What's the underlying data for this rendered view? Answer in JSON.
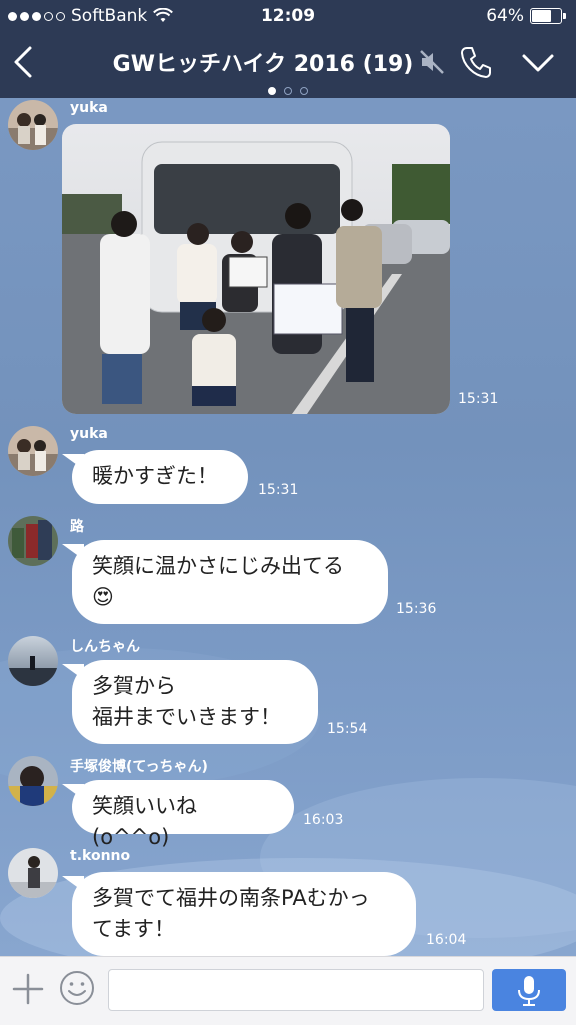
{
  "status_bar": {
    "carrier": "SoftBank",
    "time": "12:09",
    "battery_percent": "64%",
    "battery_level": 0.64,
    "signal_bars_filled": 3,
    "signal_bars_total": 5
  },
  "header": {
    "title": "GWヒッチハイク 2016 (19)",
    "muted": true,
    "page_dots": 3,
    "active_dot": 0
  },
  "messages": [
    {
      "sender": "yuka",
      "type": "image",
      "time": "15:31"
    },
    {
      "sender": "yuka",
      "text": "暖かすぎた！",
      "time": "15:31"
    },
    {
      "sender": "路",
      "lines": [
        "笑顔に温かさにじみ出てる",
        "😍"
      ],
      "time": "15:36"
    },
    {
      "sender": "しんちゃん",
      "lines": [
        "多賀から",
        "福井までいきます！"
      ],
      "time": "15:54"
    },
    {
      "sender": "手塚俊博(てっちゃん)",
      "text": "笑顔いいね(o^^o)",
      "time": "16:03"
    },
    {
      "sender": "t.konno",
      "lines": [
        "多賀でて福井の南条PAむかっ",
        "てます！"
      ],
      "time": "16:04"
    }
  ],
  "input": {
    "placeholder": ""
  },
  "colors": {
    "header_bg": "#2d3a55",
    "chat_bg": "#7594bd",
    "send_button": "#4a84e0"
  }
}
